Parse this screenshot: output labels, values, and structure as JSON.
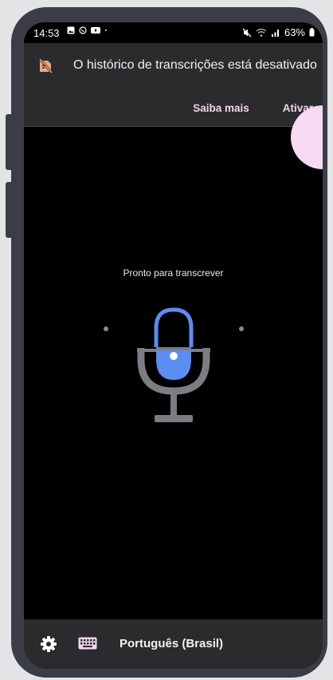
{
  "status_bar": {
    "time": "14:53",
    "battery": "63%"
  },
  "banner": {
    "message": "O histórico de transcrições está desativado",
    "learn_more": "Saiba mais",
    "activate": "Ativar"
  },
  "main": {
    "status_text": "Pronto para transcrever"
  },
  "bottom_bar": {
    "language": "Português (Brasil)"
  },
  "colors": {
    "accent_pink": "#f3d4ec",
    "mic_blue": "#5a8ef0",
    "mic_grey": "#7b7d82"
  }
}
